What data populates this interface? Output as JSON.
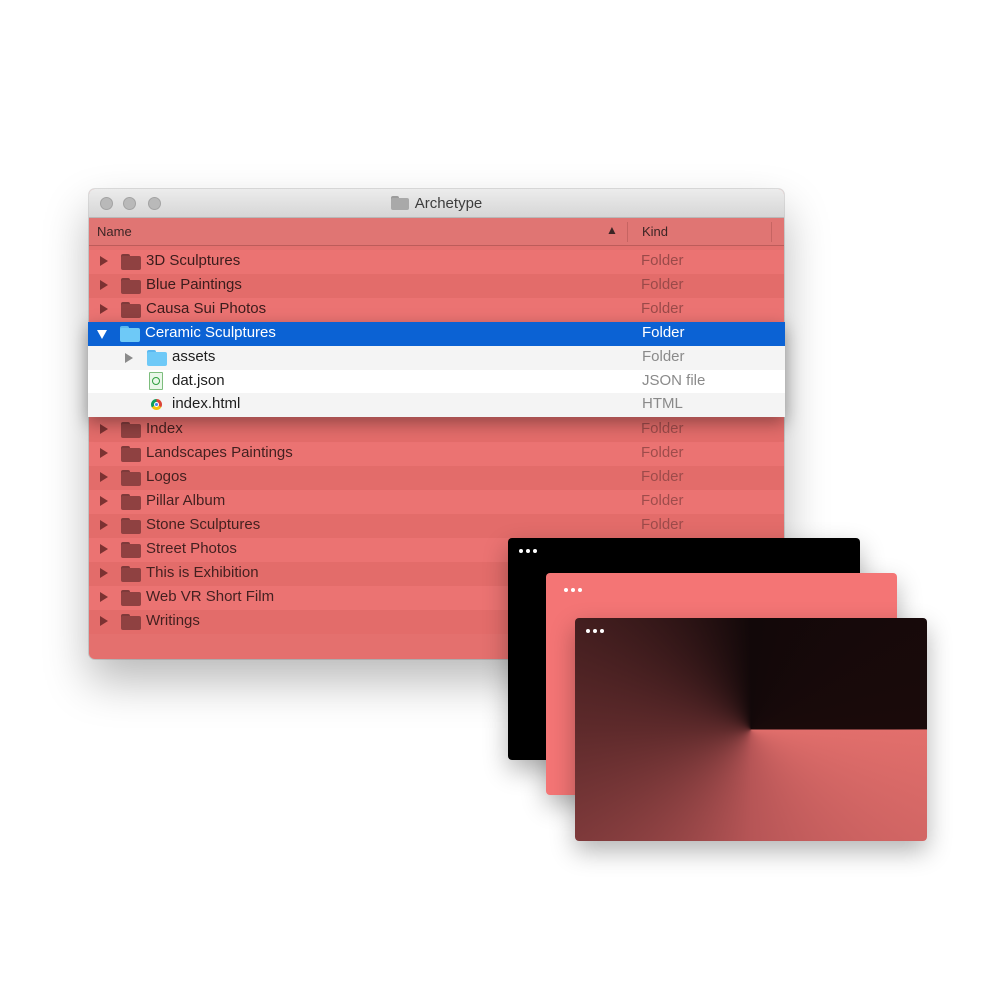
{
  "window": {
    "title": "Archetype"
  },
  "columns": {
    "name": "Name",
    "kind": "Kind",
    "sort_indicator": "▲"
  },
  "rows_top": [
    {
      "name": "3D Sculptures",
      "kind": "Folder"
    },
    {
      "name": "Blue Paintings",
      "kind": "Folder"
    },
    {
      "name": "Causa Sui Photos",
      "kind": "Folder"
    }
  ],
  "expanded": {
    "folder": {
      "name": "Ceramic Sculptures",
      "kind": "Folder"
    },
    "children": [
      {
        "name": "assets",
        "kind": "Folder",
        "icon": "folder-icon"
      },
      {
        "name": "dat.json",
        "kind": "JSON file",
        "icon": "json-file-icon"
      },
      {
        "name": "index.html",
        "kind": "HTML",
        "icon": "chrome-html-icon"
      }
    ]
  },
  "rows_bottom": [
    {
      "name": "Index",
      "kind": "Folder"
    },
    {
      "name": "Landscapes Paintings",
      "kind": "Folder"
    },
    {
      "name": "Logos",
      "kind": "Folder"
    },
    {
      "name": "Pillar Album",
      "kind": "Folder"
    },
    {
      "name": "Stone Sculptures",
      "kind": "Folder"
    },
    {
      "name": "Street Photos",
      "kind": ""
    },
    {
      "name": "This is Exhibition",
      "kind": ""
    },
    {
      "name": "Web VR Short Film",
      "kind": ""
    },
    {
      "name": "Writings",
      "kind": ""
    }
  ],
  "colors": {
    "window_tint": "#e4706e",
    "selection": "#0b62d4",
    "card_black": "#000000",
    "card_coral": "#f47575"
  }
}
